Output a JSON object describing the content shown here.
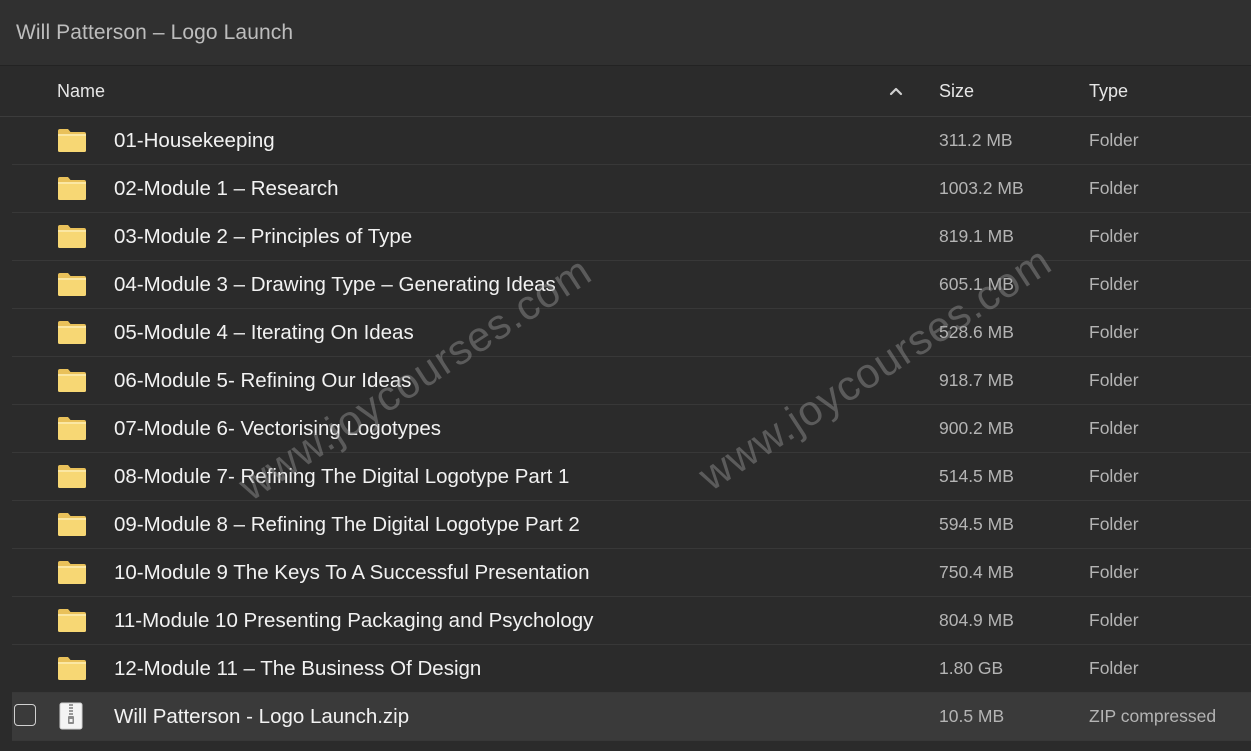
{
  "window": {
    "title": "Will Patterson – Logo Launch"
  },
  "columns": {
    "name": "Name",
    "size": "Size",
    "type": "Type",
    "sort": "ascending"
  },
  "files": [
    {
      "name": "01-Housekeeping",
      "size": "311.2 MB",
      "type": "Folder",
      "icon": "folder-icon"
    },
    {
      "name": "02-Module 1 – Research",
      "size": "1003.2 MB",
      "type": "Folder",
      "icon": "folder-icon"
    },
    {
      "name": "03-Module 2 – Principles of Type",
      "size": "819.1 MB",
      "type": "Folder",
      "icon": "folder-icon"
    },
    {
      "name": "04-Module 3 – Drawing Type – Generating Ideas",
      "size": "605.1 MB",
      "type": "Folder",
      "icon": "folder-icon"
    },
    {
      "name": "05-Module 4 – Iterating On Ideas",
      "size": "528.6 MB",
      "type": "Folder",
      "icon": "folder-icon"
    },
    {
      "name": "06-Module 5- Refining Our Ideas",
      "size": "918.7 MB",
      "type": "Folder",
      "icon": "folder-icon"
    },
    {
      "name": "07-Module 6- Vectorising Logotypes",
      "size": "900.2 MB",
      "type": "Folder",
      "icon": "folder-icon"
    },
    {
      "name": "08-Module 7- Refining The Digital Logotype Part 1",
      "size": "514.5 MB",
      "type": "Folder",
      "icon": "folder-icon"
    },
    {
      "name": "09-Module 8 – Refining The Digital Logotype Part 2",
      "size": "594.5 MB",
      "type": "Folder",
      "icon": "folder-icon"
    },
    {
      "name": "10-Module 9 The Keys To A Successful Presentation",
      "size": "750.4 MB",
      "type": "Folder",
      "icon": "folder-icon"
    },
    {
      "name": "11-Module 10 Presenting Packaging and Psychology",
      "size": "804.9 MB",
      "type": "Folder",
      "icon": "folder-icon"
    },
    {
      "name": "12-Module 11 – The Business Of Design",
      "size": "1.80 GB",
      "type": "Folder",
      "icon": "folder-icon"
    },
    {
      "name": "Will Patterson - Logo Launch.zip",
      "size": "10.5 MB",
      "type": "ZIP compressed",
      "icon": "zip-archive-icon",
      "selected": true
    }
  ],
  "watermark": {
    "text_1": "www.joycourses.com",
    "text_2": "www.joycourses.com"
  },
  "colors": {
    "background": "#2b2b2b",
    "folder": "#f7d774",
    "text": "#f2f2f2",
    "muted": "#b4b4b4"
  }
}
